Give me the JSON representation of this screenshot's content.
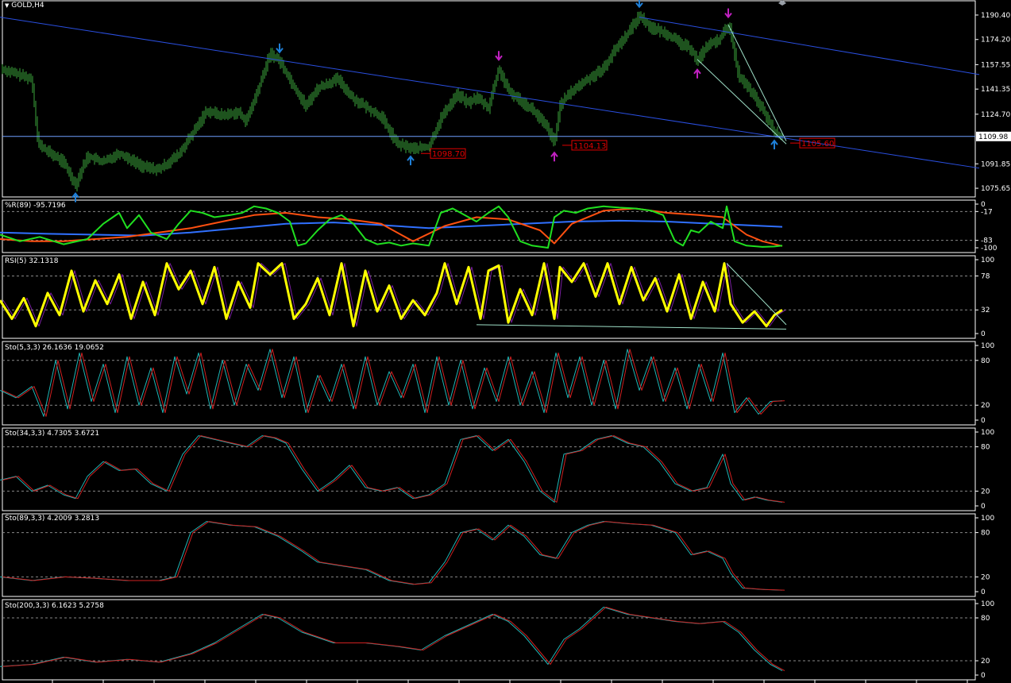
{
  "window": {
    "title": "GOLD,H4"
  },
  "colors": {
    "background": "#000000",
    "frame": "#ffffff",
    "price_bars": "#3da63d",
    "trendline": "#2a4fe0",
    "hline": "#6fa0ff",
    "wedge": "#9fe0c8",
    "arrow_blue": "#1e7fd8",
    "arrow_magenta": "#c020c0",
    "label_red": "#e00000",
    "yellow": "#ffff00",
    "rsi_shadow": "#7a1fa0",
    "green": "#20e020",
    "orange": "#ff5010",
    "blue_line": "#3070ff",
    "sto_main": "#1fb5b5",
    "sto_signal": "#d02020",
    "level": "#888888"
  },
  "chart_data": [
    {
      "type": "line",
      "title": "GOLD,H4",
      "y_ticks": [
        "1190.40",
        "1174.20",
        "1157.55",
        "1141.35",
        "1124.70",
        "1091.85",
        "1075.65"
      ],
      "current_price": "1109.98",
      "ylim": [
        1072,
        1193
      ],
      "price_path": {
        "x": [
          0,
          40,
          48,
          60,
          80,
          95,
          110,
          130,
          150,
          180,
          200,
          225,
          245,
          260,
          280,
          300,
          310,
          325,
          340,
          352,
          370,
          385,
          400,
          425,
          445,
          465,
          480,
          500,
          520,
          540,
          555,
          575,
          590,
          600,
          615,
          628,
          640,
          655,
          670,
          690,
          698,
          705,
          720,
          740,
          760,
          775,
          790,
          805,
          820,
          840,
          855,
          870,
          878,
          890,
          905,
          918,
          930,
          945,
          960,
          975,
          985
        ],
        "y": [
          1155,
          1148,
          1105,
          1100,
          1093,
          1078,
          1097,
          1093,
          1099,
          1090,
          1088,
          1098,
          1114,
          1127,
          1124,
          1126,
          1120,
          1141,
          1165,
          1160,
          1143,
          1130,
          1142,
          1148,
          1135,
          1128,
          1123,
          1105,
          1102,
          1103,
          1122,
          1138,
          1132,
          1136,
          1129,
          1155,
          1140,
          1134,
          1128,
          1115,
          1105,
          1131,
          1140,
          1148,
          1155,
          1168,
          1178,
          1190,
          1182,
          1178,
          1172,
          1168,
          1160,
          1170,
          1174,
          1184,
          1150,
          1140,
          1128,
          1113,
          1109
        ]
      },
      "annotations": {
        "price_labels": [
          {
            "x": 520,
            "value": "1098.70"
          },
          {
            "x": 698,
            "value": "1104.13"
          },
          {
            "x": 985,
            "value": "1105.60"
          }
        ],
        "up_arrows": [
          95,
          517,
          975
        ],
        "down_arrows_blue": [
          352,
          805
        ],
        "down_arrows_magenta": [
          628,
          917
        ],
        "up_arrows_magenta": [
          698,
          878
        ],
        "trendlines": [
          {
            "x1": 0,
            "y1": 1189,
            "x2": 1233,
            "y2": 1089
          },
          {
            "x1": 805,
            "y1": 1189,
            "x2": 1233,
            "y2": 1151
          },
          {
            "x1": 917,
            "y1": 1184,
            "x2": 990,
            "y2": 1107
          },
          {
            "x1": 878,
            "y1": 1161,
            "x2": 990,
            "y2": 1105
          }
        ],
        "hline": 1109.98
      }
    },
    {
      "type": "line",
      "title": "%R(89) -95.7196",
      "y_ticks": [
        "0",
        "-17",
        "-83",
        "-100"
      ],
      "ylim": [
        -100,
        0
      ],
      "series": [
        {
          "x": [
            0,
            25,
            50,
            80,
            110,
            130,
            150,
            160,
            175,
            190,
            210,
            225,
            240,
            255,
            270,
            290,
            305,
            320,
            335,
            350,
            365,
            375,
            385,
            400,
            415,
            430,
            445,
            460,
            475,
            490,
            505,
            520,
            540,
            555,
            570,
            585,
            600,
            615,
            628,
            640,
            655,
            670,
            690,
            698,
            710,
            725,
            740,
            760,
            780,
            800,
            820,
            835,
            850,
            860,
            870,
            880,
            895,
            910,
            915,
            925,
            940,
            960,
            975,
            985
          ],
          "y": [
            -70,
            -85,
            -75,
            -92,
            -80,
            -45,
            -20,
            -55,
            -25,
            -65,
            -80,
            -45,
            -15,
            -20,
            -30,
            -25,
            -20,
            -5,
            -10,
            -20,
            -40,
            -95,
            -90,
            -60,
            -35,
            -25,
            -45,
            -80,
            -92,
            -88,
            -95,
            -90,
            -95,
            -20,
            -10,
            -25,
            -40,
            -20,
            -5,
            -30,
            -85,
            -95,
            -100,
            -30,
            -15,
            -20,
            -10,
            -5,
            -8,
            -10,
            -15,
            -25,
            -85,
            -95,
            -60,
            -65,
            -40,
            -55,
            -5,
            -85,
            -95,
            -98,
            -97,
            -95
          ]
        },
        {
          "x": [
            0,
            40,
            80,
            120,
            160,
            200,
            240,
            280,
            320,
            360,
            400,
            440,
            480,
            520,
            560,
            600,
            640,
            680,
            698,
            720,
            760,
            800,
            840,
            880,
            910,
            940,
            960,
            985
          ],
          "y": [
            -80,
            -85,
            -85,
            -80,
            -75,
            -65,
            -55,
            -40,
            -25,
            -20,
            -30,
            -35,
            -45,
            -85,
            -50,
            -30,
            -35,
            -60,
            -90,
            -45,
            -15,
            -10,
            -20,
            -25,
            -30,
            -70,
            -85,
            -96
          ]
        },
        {
          "x": [
            0,
            60,
            120,
            180,
            240,
            300,
            360,
            420,
            480,
            540,
            600,
            660,
            720,
            780,
            840,
            900,
            985
          ],
          "y": [
            -65,
            -68,
            -70,
            -72,
            -65,
            -55,
            -45,
            -42,
            -48,
            -55,
            -50,
            -45,
            -40,
            -38,
            -40,
            -45,
            -52
          ]
        }
      ]
    },
    {
      "type": "line",
      "title": "RSI(5) 32.1318",
      "y_ticks": [
        "100",
        "78",
        "32",
        "0"
      ],
      "ylim": [
        0,
        100
      ],
      "series": [
        {
          "x": [
            0,
            15,
            30,
            45,
            60,
            75,
            90,
            105,
            120,
            135,
            150,
            165,
            180,
            195,
            210,
            225,
            240,
            255,
            270,
            285,
            300,
            315,
            325,
            340,
            355,
            370,
            385,
            400,
            415,
            430,
            445,
            460,
            475,
            490,
            505,
            520,
            535,
            550,
            560,
            575,
            590,
            605,
            615,
            628,
            640,
            655,
            670,
            685,
            698,
            705,
            720,
            735,
            750,
            765,
            780,
            795,
            810,
            825,
            840,
            855,
            870,
            885,
            900,
            912,
            920,
            935,
            950,
            965,
            975,
            985
          ],
          "y": [
            45,
            20,
            48,
            10,
            55,
            25,
            85,
            30,
            72,
            40,
            80,
            20,
            70,
            25,
            95,
            60,
            85,
            40,
            90,
            20,
            70,
            35,
            95,
            80,
            95,
            20,
            40,
            75,
            25,
            95,
            10,
            85,
            30,
            65,
            20,
            45,
            25,
            55,
            95,
            40,
            90,
            20,
            85,
            92,
            15,
            60,
            25,
            95,
            20,
            90,
            70,
            95,
            50,
            95,
            40,
            90,
            45,
            75,
            30,
            80,
            20,
            70,
            30,
            95,
            40,
            15,
            30,
            10,
            25,
            32
          ]
        }
      ]
    },
    {
      "type": "line",
      "title": "Sto(5,3,3) 26.1636 19.0652",
      "y_ticks": [
        "100",
        "80",
        "20",
        "0"
      ],
      "ylim": [
        0,
        100
      ],
      "series": [
        {
          "x": [
            0,
            20,
            40,
            55,
            70,
            85,
            100,
            115,
            130,
            145,
            160,
            175,
            190,
            205,
            220,
            235,
            250,
            265,
            280,
            295,
            310,
            325,
            340,
            355,
            370,
            385,
            400,
            415,
            430,
            445,
            460,
            475,
            490,
            505,
            520,
            535,
            550,
            565,
            580,
            595,
            610,
            625,
            640,
            655,
            670,
            685,
            700,
            715,
            730,
            745,
            760,
            775,
            790,
            805,
            820,
            835,
            850,
            865,
            880,
            895,
            910,
            925,
            940,
            955,
            970,
            985
          ],
          "y": [
            40,
            30,
            45,
            5,
            80,
            15,
            90,
            25,
            75,
            10,
            85,
            20,
            70,
            10,
            85,
            35,
            90,
            15,
            80,
            20,
            75,
            40,
            95,
            30,
            85,
            10,
            60,
            25,
            75,
            15,
            85,
            20,
            65,
            30,
            75,
            10,
            85,
            20,
            80,
            15,
            70,
            25,
            85,
            20,
            65,
            10,
            90,
            30,
            85,
            20,
            80,
            15,
            95,
            40,
            85,
            25,
            70,
            15,
            75,
            25,
            90,
            10,
            30,
            8,
            25,
            26
          ]
        }
      ]
    },
    {
      "type": "line",
      "title": "Sto(34,3,3) 4.7305 3.6721",
      "y_ticks": [
        "100",
        "80",
        "20",
        "0"
      ],
      "ylim": [
        0,
        100
      ],
      "series": [
        {
          "x": [
            0,
            20,
            40,
            60,
            80,
            95,
            110,
            130,
            150,
            170,
            190,
            210,
            230,
            250,
            270,
            290,
            310,
            330,
            345,
            360,
            380,
            400,
            420,
            440,
            460,
            480,
            500,
            520,
            540,
            560,
            580,
            600,
            620,
            640,
            660,
            680,
            698,
            710,
            730,
            750,
            770,
            790,
            810,
            830,
            850,
            870,
            890,
            910,
            920,
            935,
            950,
            965,
            985
          ],
          "y": [
            35,
            40,
            20,
            28,
            15,
            10,
            40,
            60,
            48,
            50,
            30,
            20,
            70,
            95,
            90,
            85,
            80,
            95,
            92,
            85,
            50,
            20,
            35,
            55,
            25,
            20,
            25,
            10,
            15,
            30,
            90,
            95,
            75,
            90,
            60,
            20,
            5,
            70,
            75,
            90,
            95,
            85,
            80,
            60,
            30,
            20,
            25,
            70,
            30,
            8,
            12,
            8,
            5
          ]
        }
      ]
    },
    {
      "type": "line",
      "title": "Sto(89,3,3) 4.2009 3.2813",
      "y_ticks": [
        "100",
        "80",
        "20",
        "0"
      ],
      "ylim": [
        0,
        100
      ],
      "series": [
        {
          "x": [
            0,
            40,
            80,
            120,
            160,
            200,
            220,
            240,
            260,
            290,
            320,
            350,
            380,
            400,
            430,
            460,
            490,
            520,
            540,
            560,
            580,
            600,
            620,
            640,
            660,
            680,
            700,
            720,
            740,
            760,
            790,
            820,
            850,
            870,
            890,
            910,
            920,
            935,
            960,
            985
          ],
          "y": [
            20,
            15,
            20,
            18,
            15,
            15,
            20,
            80,
            95,
            90,
            88,
            75,
            55,
            40,
            35,
            30,
            15,
            10,
            12,
            40,
            80,
            85,
            70,
            90,
            75,
            50,
            45,
            80,
            90,
            95,
            92,
            90,
            80,
            50,
            55,
            45,
            25,
            5,
            3,
            2
          ]
        }
      ]
    },
    {
      "type": "line",
      "title": "Sto(200,3,3) 6.1623 5.2758",
      "y_ticks": [
        "100",
        "80",
        "20",
        "0"
      ],
      "ylim": [
        0,
        100
      ],
      "series": [
        {
          "x": [
            0,
            40,
            80,
            120,
            160,
            200,
            240,
            270,
            300,
            330,
            350,
            380,
            420,
            460,
            500,
            530,
            560,
            590,
            620,
            640,
            660,
            690,
            710,
            730,
            760,
            790,
            820,
            850,
            880,
            910,
            930,
            950,
            970,
            985
          ],
          "y": [
            12,
            15,
            25,
            18,
            22,
            18,
            30,
            45,
            65,
            85,
            80,
            60,
            45,
            45,
            40,
            35,
            55,
            70,
            85,
            75,
            55,
            15,
            50,
            65,
            95,
            85,
            80,
            75,
            72,
            75,
            60,
            35,
            15,
            6
          ]
        }
      ]
    }
  ]
}
